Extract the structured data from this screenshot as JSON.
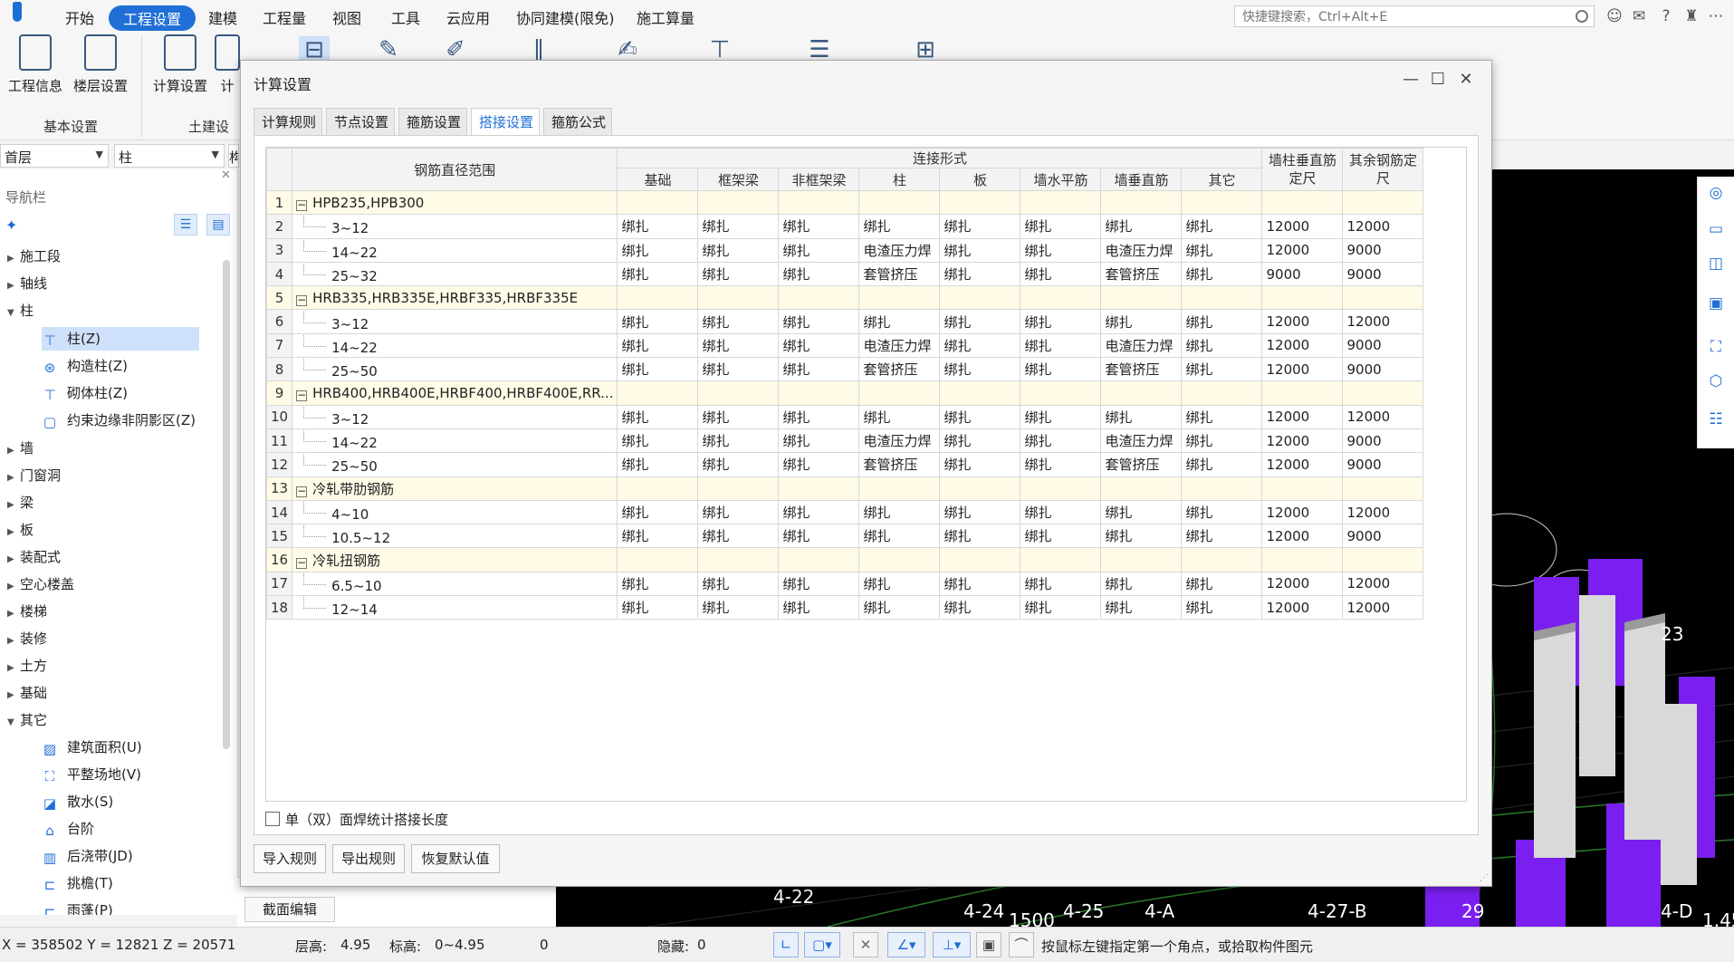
{
  "menu": {
    "items": [
      "开始",
      "工程设置",
      "建模",
      "工程量",
      "视图",
      "工具",
      "云应用",
      "协同建模(限免)",
      "施工算量"
    ],
    "active_index": 1,
    "search_placeholder": "快捷键搜索，Ctrl+Alt+E"
  },
  "ribbon": {
    "buttons": [
      "工程信息",
      "楼层设置",
      "计算设置",
      "计"
    ],
    "groups": [
      "基本设置",
      "土建设"
    ]
  },
  "selector": {
    "floor": "首层",
    "component": "柱",
    "third": "构"
  },
  "nav": {
    "title": "导航栏",
    "tree": [
      "施工段",
      "轴线",
      "柱"
    ],
    "column_children": [
      "柱(Z)",
      "构造柱(Z)",
      "砌体柱(Z)",
      "约束边缘非阴影区(Z)"
    ],
    "tree2": [
      "墙",
      "门窗洞",
      "梁",
      "板",
      "装配式",
      "空心楼盖",
      "楼梯",
      "装修",
      "土方",
      "基础",
      "其它"
    ],
    "other_children": [
      "建筑面积(U)",
      "平整场地(V)",
      "散水(S)",
      "台阶",
      "后浇带(JD)",
      "挑檐(T)",
      "雨蓬(P)"
    ]
  },
  "under_panel": {
    "button": "截面编辑"
  },
  "status": {
    "coords": "X = 358502 Y = 12821 Z = 20571",
    "floor_height_label": "层高:",
    "floor_height": "4.95",
    "elevation_label": "标高:",
    "elevation": "0~4.95",
    "zero": "0",
    "hidden_label": "隐藏:",
    "hidden": "0",
    "hint": "按鼠标左键指定第一个角点，或拾取构件图元"
  },
  "canvas_labels": [
    "4-22",
    "4-24",
    "1500",
    "4-25",
    "4-A",
    "4-27-B",
    "29",
    "4-D",
    "1.45",
    "23"
  ],
  "dialog": {
    "title": "计算设置",
    "tabs": [
      "计算规则",
      "节点设置",
      "箍筋设置",
      "搭接设置",
      "箍筋公式"
    ],
    "active_tab": 3,
    "header": {
      "range": "钢筋直径范围",
      "conn_group": "连接形式",
      "conn_cols": [
        "基础",
        "框架梁",
        "非框架梁",
        "柱",
        "板",
        "墙水平筋",
        "墙垂直筋",
        "其它"
      ],
      "wall_col": "墙柱垂直筋定尺",
      "other_col": "其余钢筋定尺"
    },
    "rows": [
      {
        "n": "1",
        "group": true,
        "name": "HPB235,HPB300"
      },
      {
        "n": "2",
        "name": "3~12",
        "c": [
          "绑扎",
          "绑扎",
          "绑扎",
          "绑扎",
          "绑扎",
          "绑扎",
          "绑扎",
          "绑扎"
        ],
        "w": "12000",
        "o": "12000"
      },
      {
        "n": "3",
        "name": "14~22",
        "c": [
          "绑扎",
          "绑扎",
          "绑扎",
          "电渣压力焊",
          "绑扎",
          "绑扎",
          "电渣压力焊",
          "绑扎"
        ],
        "w": "12000",
        "o": "9000"
      },
      {
        "n": "4",
        "name": "25~32",
        "c": [
          "绑扎",
          "绑扎",
          "绑扎",
          "套管挤压",
          "绑扎",
          "绑扎",
          "套管挤压",
          "绑扎"
        ],
        "w": "9000",
        "o": "9000"
      },
      {
        "n": "5",
        "group": true,
        "name": "HRB335,HRB335E,HRBF335,HRBF335E"
      },
      {
        "n": "6",
        "name": "3~12",
        "c": [
          "绑扎",
          "绑扎",
          "绑扎",
          "绑扎",
          "绑扎",
          "绑扎",
          "绑扎",
          "绑扎"
        ],
        "w": "12000",
        "o": "12000"
      },
      {
        "n": "7",
        "name": "14~22",
        "c": [
          "绑扎",
          "绑扎",
          "绑扎",
          "电渣压力焊",
          "绑扎",
          "绑扎",
          "电渣压力焊",
          "绑扎"
        ],
        "w": "12000",
        "o": "9000"
      },
      {
        "n": "8",
        "name": "25~50",
        "c": [
          "绑扎",
          "绑扎",
          "绑扎",
          "套管挤压",
          "绑扎",
          "绑扎",
          "套管挤压",
          "绑扎"
        ],
        "w": "12000",
        "o": "9000"
      },
      {
        "n": "9",
        "group": true,
        "name": "HRB400,HRB400E,HRBF400,HRBF400E,RR..."
      },
      {
        "n": "10",
        "name": "3~12",
        "c": [
          "绑扎",
          "绑扎",
          "绑扎",
          "绑扎",
          "绑扎",
          "绑扎",
          "绑扎",
          "绑扎"
        ],
        "w": "12000",
        "o": "12000"
      },
      {
        "n": "11",
        "name": "14~22",
        "c": [
          "绑扎",
          "绑扎",
          "绑扎",
          "电渣压力焊",
          "绑扎",
          "绑扎",
          "电渣压力焊",
          "绑扎"
        ],
        "w": "12000",
        "o": "9000"
      },
      {
        "n": "12",
        "name": "25~50",
        "c": [
          "绑扎",
          "绑扎",
          "绑扎",
          "套管挤压",
          "绑扎",
          "绑扎",
          "套管挤压",
          "绑扎"
        ],
        "w": "12000",
        "o": "9000"
      },
      {
        "n": "13",
        "group": true,
        "name": "冷轧带肋钢筋"
      },
      {
        "n": "14",
        "name": "4~10",
        "c": [
          "绑扎",
          "绑扎",
          "绑扎",
          "绑扎",
          "绑扎",
          "绑扎",
          "绑扎",
          "绑扎"
        ],
        "w": "12000",
        "o": "12000"
      },
      {
        "n": "15",
        "name": "10.5~12",
        "c": [
          "绑扎",
          "绑扎",
          "绑扎",
          "绑扎",
          "绑扎",
          "绑扎",
          "绑扎",
          "绑扎"
        ],
        "w": "12000",
        "o": "9000"
      },
      {
        "n": "16",
        "group": true,
        "name": "冷轧扭钢筋"
      },
      {
        "n": "17",
        "name": "6.5~10",
        "c": [
          "绑扎",
          "绑扎",
          "绑扎",
          "绑扎",
          "绑扎",
          "绑扎",
          "绑扎",
          "绑扎"
        ],
        "w": "12000",
        "o": "12000"
      },
      {
        "n": "18",
        "name": "12~14",
        "c": [
          "绑扎",
          "绑扎",
          "绑扎",
          "绑扎",
          "绑扎",
          "绑扎",
          "绑扎",
          "绑扎"
        ],
        "w": "12000",
        "o": "12000"
      }
    ],
    "checkbox_label": "单（双）面焊统计搭接长度",
    "buttons": [
      "导入规则",
      "导出规则",
      "恢复默认值"
    ]
  }
}
